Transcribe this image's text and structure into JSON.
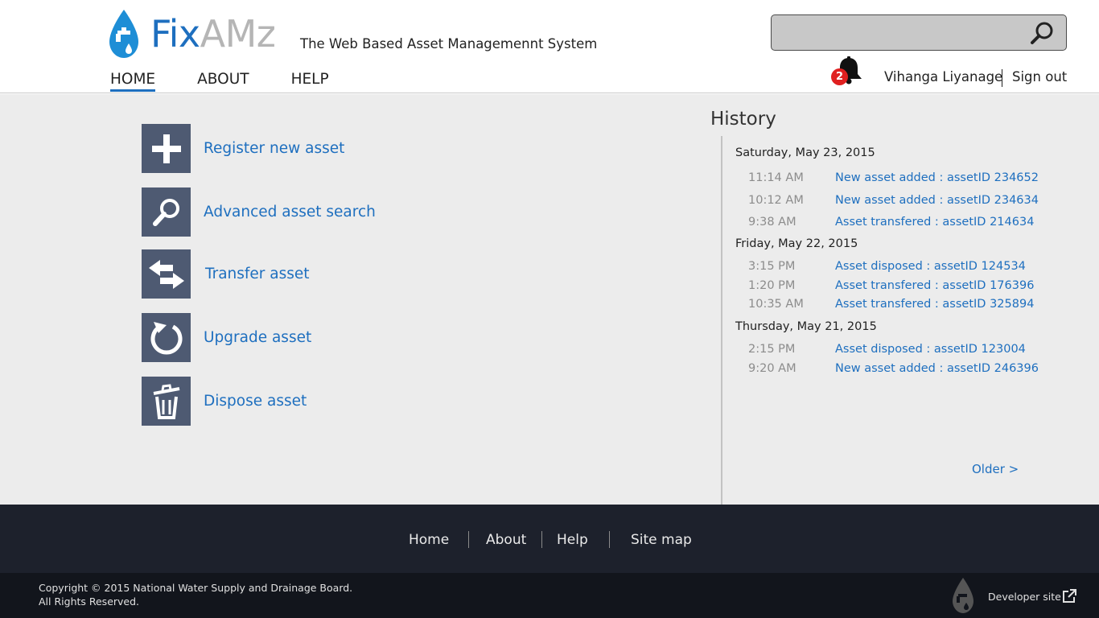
{
  "brand": {
    "name_part1": "Fix",
    "name_part2": "AMz",
    "tagline": "The Web Based Asset Managemennt System"
  },
  "nav": {
    "items": [
      {
        "label": "HOME",
        "active": true
      },
      {
        "label": "ABOUT"
      },
      {
        "label": "HELP"
      }
    ]
  },
  "search": {
    "value": "",
    "placeholder": ""
  },
  "user": {
    "notification_count": "2",
    "name": "Vihanga Liyanage",
    "signout_label": "Sign out"
  },
  "actions": [
    {
      "label": "Register new asset",
      "icon": "plus-icon"
    },
    {
      "label": "Advanced asset search",
      "icon": "magnifier-icon"
    },
    {
      "label": "Transfer asset",
      "icon": "transfer-arrows-icon"
    },
    {
      "label": "Upgrade asset",
      "icon": "refresh-icon"
    },
    {
      "label": "Dispose asset",
      "icon": "trash-icon"
    }
  ],
  "history": {
    "title": "History",
    "days": [
      {
        "date": "Saturday, May 23, 2015",
        "entries": [
          {
            "time": "11:14 AM",
            "text": "New asset added : assetID 234652"
          },
          {
            "time": "10:12 AM",
            "text": "New asset added : assetID 234634"
          },
          {
            "time": "9:38 AM",
            "text": "Asset transfered : assetID 214634"
          }
        ]
      },
      {
        "date": "Friday, May 22, 2015",
        "entries": [
          {
            "time": "3:15 PM",
            "text": "Asset disposed : assetID 124534"
          },
          {
            "time": "1:20 PM",
            "text": "Asset transfered : assetID 176396"
          },
          {
            "time": "10:35 AM",
            "text": "Asset transfered : assetID 325894"
          }
        ]
      },
      {
        "date": "Thursday, May 21, 2015",
        "entries": [
          {
            "time": "2:15 PM",
            "text": "Asset disposed : assetID 123004"
          },
          {
            "time": "9:20 AM",
            "text": "New asset added : assetID 246396"
          }
        ]
      }
    ],
    "older_label": "Older >"
  },
  "footer": {
    "nav": [
      "Home",
      "About",
      "Help",
      "Site map"
    ],
    "copyright_line1": "Copyright © 2015 National Water Supply and Drainage Board.",
    "copyright_line2": "All Rights Reserved.",
    "developer_site": "Developer site"
  },
  "colors": {
    "accent": "#1e6fbf",
    "tile": "#4e5a72",
    "footer_top": "#1d212c",
    "footer_bottom": "#12151c",
    "badge": "#e02020"
  }
}
